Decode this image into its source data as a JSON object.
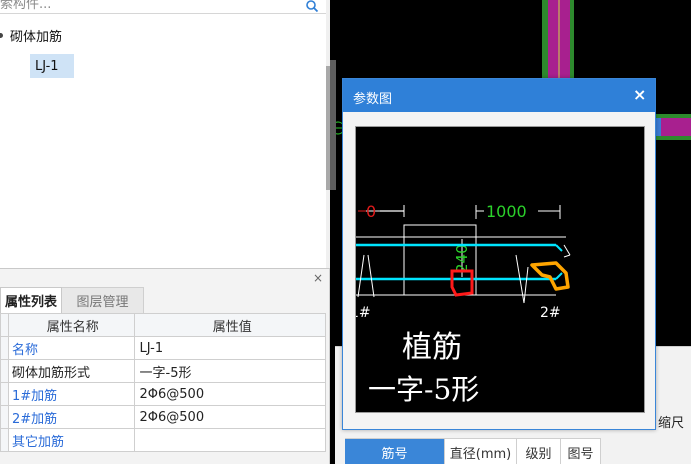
{
  "search": {
    "placeholder": "索构件..."
  },
  "tree": {
    "root_label": "砌体加筋",
    "child_label": "LJ-1"
  },
  "properties": {
    "close_glyph": "×",
    "tabs": [
      "属性列表",
      "图层管理"
    ],
    "columns": [
      "属性名称",
      "属性值"
    ],
    "rows": [
      {
        "name": "名称",
        "value": "LJ-1"
      },
      {
        "name": "砌体加筋形式",
        "value": "一字-5形"
      },
      {
        "name": "1#加筋",
        "value": "2Φ6@500"
      },
      {
        "name": "2#加筋",
        "value": "2Φ6@500"
      },
      {
        "name": "其它加筋",
        "value": ""
      }
    ]
  },
  "dialog": {
    "title": "参数图",
    "close_glyph": "×",
    "diagram": {
      "dim_left": "0",
      "dim_right": "1000",
      "dim_vertical": "240",
      "label_1": "1#",
      "label_2": "2#",
      "title_line1": "植筋",
      "title_line2": "一字-5形"
    }
  },
  "dock": {
    "label": "缩尺",
    "columns": [
      "筋号",
      "直径(mm)",
      "级别",
      "图号"
    ]
  },
  "colors": {
    "dialog_title_bg": "#2f80d8",
    "rebar_cyan": "#00e5ff",
    "dim_green": "#2bd12b",
    "dim_red": "#e01b1b",
    "highlight_red": "#ff1a1a",
    "highlight_orange": "#ffa500"
  }
}
